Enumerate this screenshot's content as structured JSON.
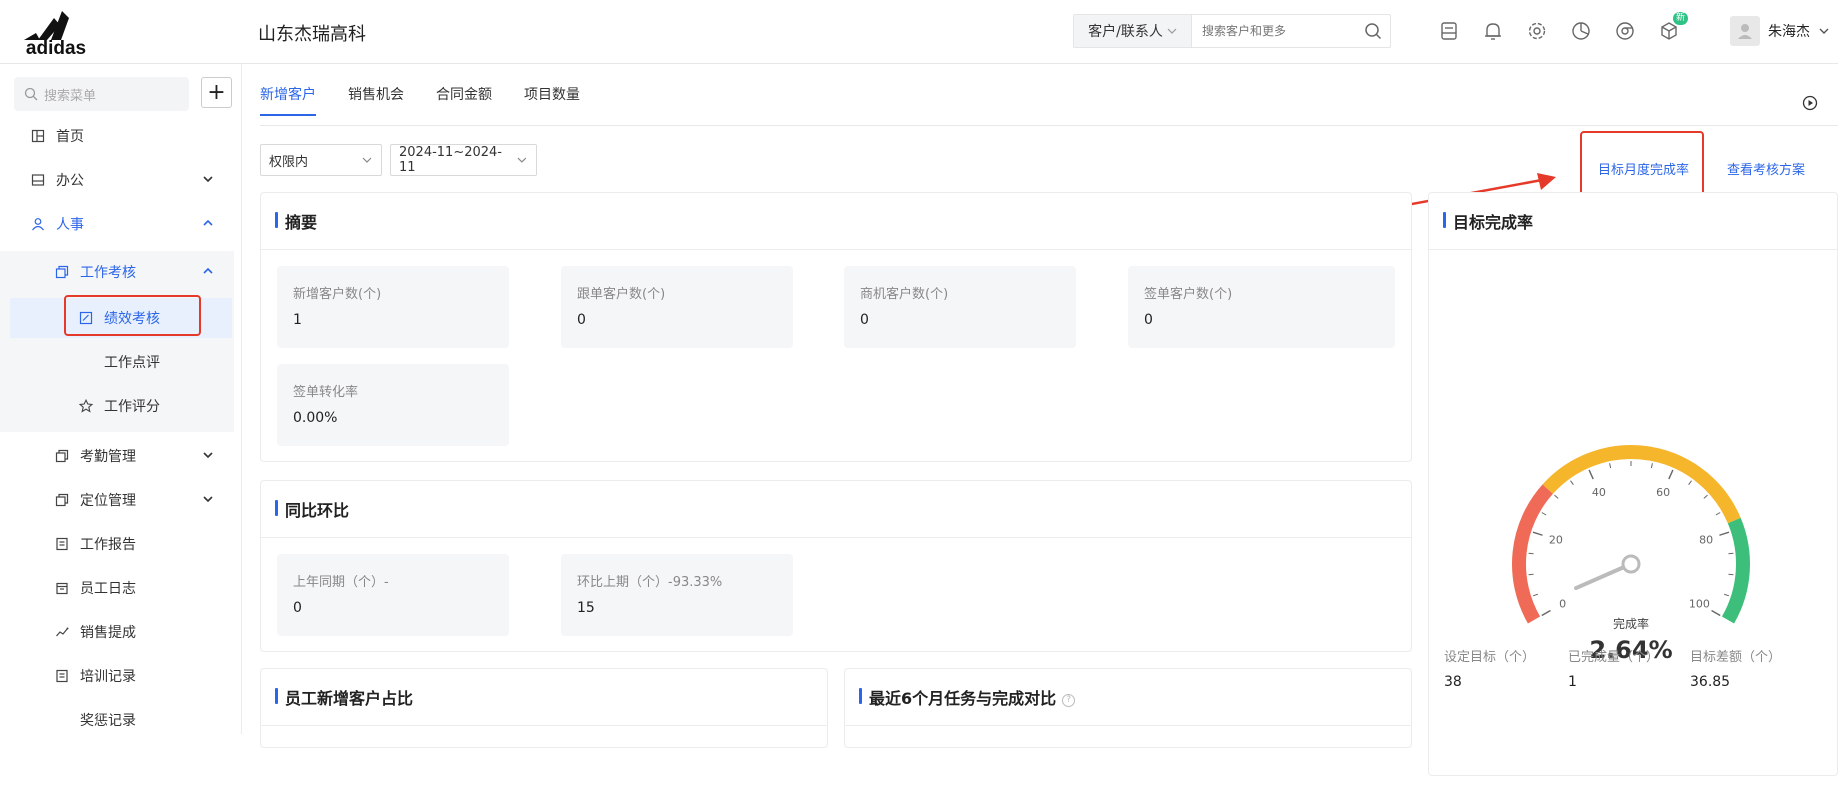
{
  "header": {
    "logo_text": "adidas",
    "company": "山东杰瑞高科",
    "search_type": "客户/联系人",
    "search_placeholder": "搜索客户和更多",
    "badge": "新",
    "user_name": "朱海杰"
  },
  "sidebar": {
    "search_placeholder": "搜索菜单",
    "plus": "+",
    "items": [
      {
        "label": "首页"
      },
      {
        "label": "办公"
      },
      {
        "label": "人事"
      },
      {
        "label": "工作考核"
      },
      {
        "label": "绩效考核"
      },
      {
        "label": "工作点评"
      },
      {
        "label": "工作评分"
      },
      {
        "label": "考勤管理"
      },
      {
        "label": "定位管理"
      },
      {
        "label": "工作报告"
      },
      {
        "label": "员工日志"
      },
      {
        "label": "销售提成"
      },
      {
        "label": "培训记录"
      },
      {
        "label": "奖惩记录"
      }
    ]
  },
  "tabs": [
    "新增客户",
    "销售机会",
    "合同金额",
    "项目数量"
  ],
  "filters": {
    "scope": "权限内",
    "date_range": "2024-11~2024-11"
  },
  "links": {
    "target_rate": "目标月度完成率",
    "view_plan": "查看考核方案"
  },
  "colors": {
    "accent": "#2c66e8",
    "highlight": "#e53a2a",
    "gauge_red": "#ef6b57",
    "gauge_yellow": "#f5b62c",
    "gauge_green": "#3dbf7b"
  },
  "summary": {
    "title": "摘要",
    "stats": [
      {
        "label": "新增客户数(个)",
        "value": "1"
      },
      {
        "label": "跟单客户数(个)",
        "value": "0"
      },
      {
        "label": "商机客户数(个)",
        "value": "0"
      },
      {
        "label": "签单客户数(个)",
        "value": "0"
      },
      {
        "label": "签单转化率",
        "value": "0.00%"
      }
    ]
  },
  "yoy": {
    "title": "同比环比",
    "stats": [
      {
        "label": "上年同期（个）-",
        "value": "0"
      },
      {
        "label": "环比上期（个）-93.33%",
        "value": "15"
      }
    ]
  },
  "employee_share": {
    "title": "员工新增客户占比"
  },
  "recent_six": {
    "title": "最近6个月任务与完成对比",
    "help": "?"
  },
  "gauge": {
    "title": "目标完成率",
    "center_label": "完成率",
    "value_text": "2.64%",
    "value": 2.64,
    "ticks": [
      "0",
      "20",
      "40",
      "60",
      "80",
      "100"
    ],
    "footer": [
      {
        "label": "设定目标（个）",
        "value": "38"
      },
      {
        "label": "已完成量（个）",
        "value": "1"
      },
      {
        "label": "目标差额（个）",
        "value": "36.85"
      }
    ]
  }
}
